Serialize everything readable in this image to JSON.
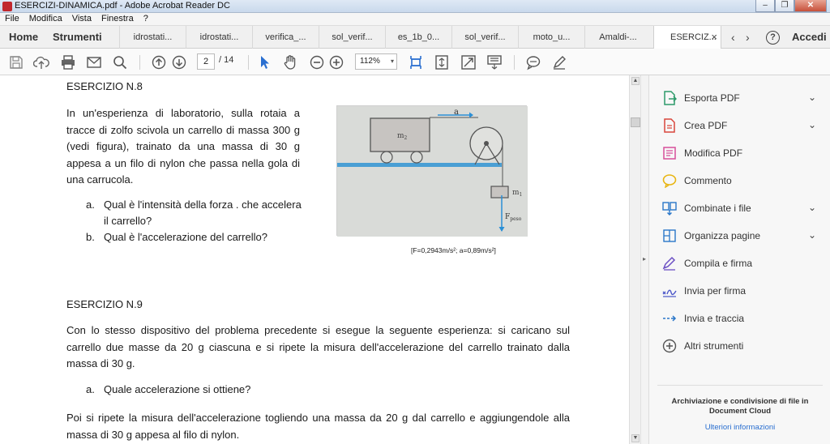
{
  "window": {
    "title": "ESERCIZI-DINAMICA.pdf - Adobe Acrobat Reader DC",
    "minimize": "–",
    "maximize": "❐",
    "close": "✕"
  },
  "menu": [
    "File",
    "Modifica",
    "Vista",
    "Finestra",
    "?"
  ],
  "tabs": {
    "home": "Home",
    "tools": "Strumenti",
    "documents": [
      "idrostati...",
      "idrostati...",
      "verifica_...",
      "sol_verif...",
      "es_1b_0...",
      "sol_verif...",
      "moto_u...",
      "Amaldi-...",
      "ESERCIZ..."
    ],
    "close": "×",
    "prev": "‹",
    "next": "›",
    "help": "?",
    "signin": "Accedi"
  },
  "toolbar": {
    "page_current": "2",
    "page_total": "/ 14",
    "zoom": "112%",
    "zoom_caret": "▾"
  },
  "document": {
    "ex8_title": "ESERCIZIO N.8",
    "ex8_text": "In un'esperienza di laboratorio, sulla rotaia a tracce di zolfo scivola un carrello di massa 300 g (vedi figura), trainato da una massa di 30 g appesa a un filo di nylon che passa nella gola di una carrucola.",
    "ex8_questions": [
      {
        "mark": "a.",
        "text": "Qual è l'intensità della forza . che accelera il carrello?"
      },
      {
        "mark": "b.",
        "text": "Qual è l'accelerazione del carrello?"
      }
    ],
    "figure": {
      "m2": "m",
      "m2_sub": "2",
      "m1": "m",
      "m1_sub": "1",
      "a": "a",
      "fpeso": "F",
      "fpeso_sub": "peso"
    },
    "ex8_answer": "[F=0,2943m/s²; a=0,89m/s²]",
    "ex9_title": "ESERCIZIO N.9",
    "ex9_text": "Con lo stesso dispositivo del problema precedente si esegue la seguente esperienza: si caricano sul carrello due masse da 20 g ciascuna e si ripete la misura dell'accelerazione del carrello trainato dalla massa di 30 g.",
    "ex9_question": {
      "mark": "a.",
      "text": "Quale accelerazione si ottiene?"
    },
    "ex9_text2": "Poi si ripete la misura dell'accelerazione togliendo una massa da 20 g dal carrello e aggiungendole alla massa di 30 g appesa al filo di nylon."
  },
  "right_panel": {
    "items": [
      {
        "label": "Esporta PDF",
        "icon": "export-pdf-icon",
        "color": "#2d9a6a",
        "chevron": "⌄"
      },
      {
        "label": "Crea PDF",
        "icon": "create-pdf-icon",
        "color": "#d9473c",
        "chevron": "⌄"
      },
      {
        "label": "Modifica PDF",
        "icon": "edit-pdf-icon",
        "color": "#d74f9a",
        "chevron": ""
      },
      {
        "label": "Commento",
        "icon": "comment-icon",
        "color": "#e8b512",
        "chevron": ""
      },
      {
        "label": "Combinate i file",
        "icon": "combine-files-icon",
        "color": "#2a77c9",
        "chevron": "⌄"
      },
      {
        "label": "Organizza pagine",
        "icon": "organize-pages-icon",
        "color": "#2a77c9",
        "chevron": "⌄"
      },
      {
        "label": "Compila e firma",
        "icon": "fill-sign-icon",
        "color": "#6b4fc4",
        "chevron": ""
      },
      {
        "label": "Invia per firma",
        "icon": "send-for-signature-icon",
        "color": "#4a55c8",
        "chevron": ""
      },
      {
        "label": "Invia e traccia",
        "icon": "send-track-icon",
        "color": "#2a77c9",
        "chevron": ""
      },
      {
        "label": "Altri strumenti",
        "icon": "more-tools-icon",
        "color": "#555555",
        "chevron": ""
      }
    ],
    "cloud_text": "Archiviazione e condivisione di file in Document Cloud",
    "cloud_link": "Ulteriori informazioni"
  }
}
